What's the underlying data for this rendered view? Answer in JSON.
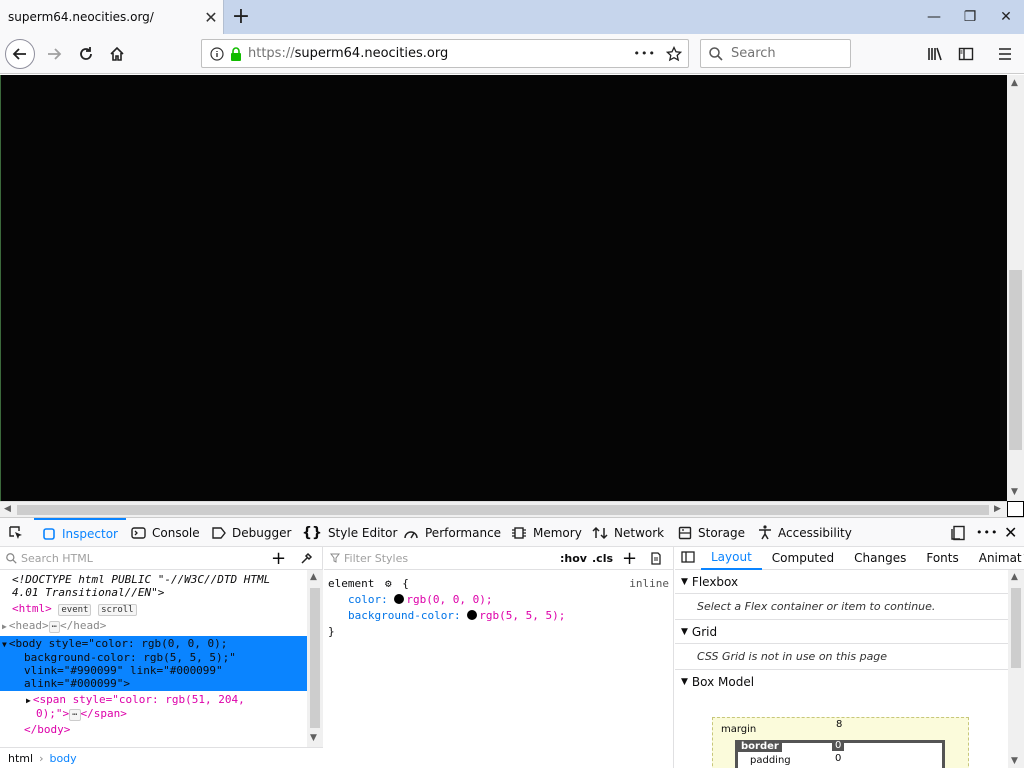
{
  "tab": {
    "title": "superm64.neocities.org/",
    "close": "✕",
    "new": "+"
  },
  "window": {
    "minimize": "—",
    "restore": "❐",
    "close": "✕"
  },
  "nav": {
    "url_scheme": "https://",
    "url_host": "superm64.neocities.org",
    "dots": "•••",
    "search_placeholder": "Search"
  },
  "devtools": {
    "tabs": [
      "Inspector",
      "Console",
      "Debugger",
      "Style Editor",
      "Performance",
      "Memory",
      "Network",
      "Storage",
      "Accessibility"
    ],
    "more": "•••"
  },
  "markup": {
    "search_placeholder": "Search HTML",
    "doctype1": "<!DOCTYPE html PUBLIC \"-//W3C//DTD HTML",
    "doctype2": "4.01 Transitional//EN\">",
    "html_tag": "<html>",
    "badge_event": "event",
    "badge_scroll": "scroll",
    "head_open": "<head>",
    "head_close": "</head>",
    "ellipsis": "⋯",
    "body1": "<body style=\"color: rgb(0, 0, 0);",
    "body2": "background-color: rgb(5, 5, 5);\"",
    "body3": "vlink=\"#990099\" link=\"#000099\"",
    "body4": "alink=\"#000099\">",
    "span1": "<span style=\"color: rgb(51, 204,",
    "span2": "0);\">",
    "span_close": "</span>",
    "body_close": "</body>"
  },
  "breadcrumbs": [
    "html",
    "body"
  ],
  "rules": {
    "filter_placeholder": "Filter Styles",
    "hov": ":hov",
    "cls": ".cls",
    "selector": "element",
    "brace_open": "{",
    "brace_close": "}",
    "source": "inline",
    "props": [
      {
        "name": "color:",
        "value": "rgb(0, 0, 0);"
      },
      {
        "name": "background-color:",
        "value": "rgb(5, 5, 5);"
      }
    ]
  },
  "side": {
    "tabs": [
      "Layout",
      "Computed",
      "Changes",
      "Fonts",
      "Animat"
    ],
    "flexbox_title": "Flexbox",
    "flexbox_msg": "Select a Flex container or item to continue.",
    "grid_title": "Grid",
    "grid_msg": "CSS Grid is not in use on this page",
    "boxmodel_title": "Box Model",
    "bm_margin": "margin",
    "bm_border": "border",
    "bm_padding": "padding",
    "bm_margin_top": "8",
    "bm_border_top": "0",
    "bm_padding_top": "0"
  },
  "colors": {
    "accent": "#0a84ff",
    "content_bg": "#050505"
  }
}
